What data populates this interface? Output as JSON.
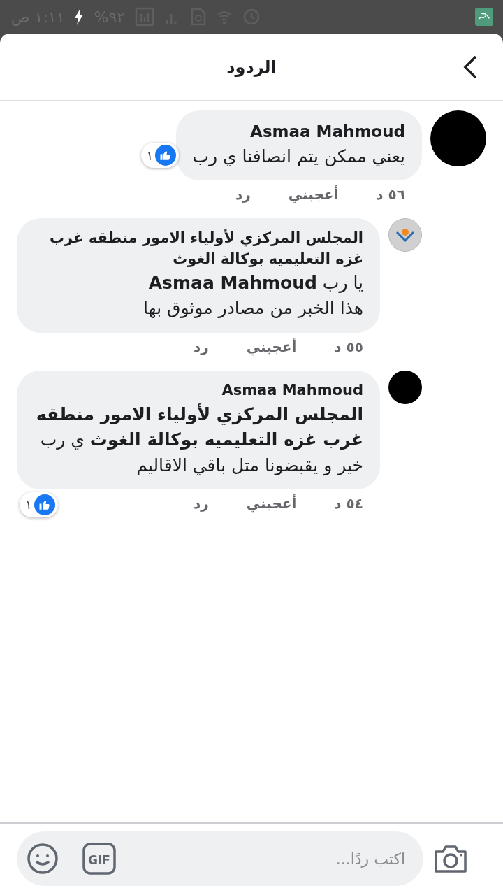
{
  "status_bar": {
    "time": "١:١١ ص",
    "battery": "٩٢%",
    "charging": true
  },
  "header": {
    "title": "الردود"
  },
  "comments": [
    {
      "author": "Asmaa Mahmoud",
      "avatar": {
        "kind": "photo"
      },
      "body_lines": [
        "يعني ممكن يتم انصافنا ي رب"
      ],
      "time": "٥٦ د",
      "like_label": "أعجبني",
      "reply_label": "رد",
      "reaction": {
        "count": "١",
        "kind": "side"
      },
      "replies": [
        {
          "author": "المجلس المركزي لأولياء الامور منطقه غرب غزه التعليميه بوكالة الغوث",
          "avatar": {
            "kind": "logo"
          },
          "body_lines": [
            "يا رب **Asmaa Mahmoud**",
            "هذا الخبر من مصادر موثوق بها"
          ],
          "time": "٥٥ د",
          "like_label": "أعجبني",
          "reply_label": "رد"
        },
        {
          "author": "Asmaa Mahmoud",
          "avatar": {
            "kind": "photo"
          },
          "body_lines": [
            "**المجلس المركزي لأولياء الامور منطقه غرب غزه التعليميه بوكالة الغوث** ي رب خير و يقبضونا متل باقي الاقاليم"
          ],
          "time": "٥٤ د",
          "like_label": "أعجبني",
          "reply_label": "رد",
          "reaction": {
            "count": "١",
            "kind": "bottom"
          }
        }
      ]
    }
  ],
  "composer": {
    "placeholder": "اكتب ردًا...",
    "gif_label": "GIF"
  }
}
